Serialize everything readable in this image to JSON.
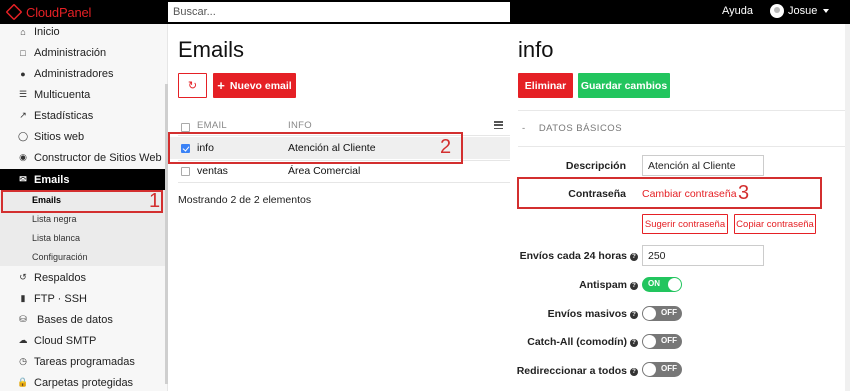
{
  "app": {
    "brand": "CloudPanel"
  },
  "topbar": {
    "search_placeholder": "Buscar...",
    "help": "Ayuda",
    "user": "Josue"
  },
  "sidebar": {
    "items": [
      {
        "label": "Inicio",
        "icon": "home-icon"
      },
      {
        "label": "Administración",
        "icon": "file-icon"
      },
      {
        "label": "Administradores",
        "icon": "users-icon"
      },
      {
        "label": "Multicuenta",
        "icon": "list-icon"
      },
      {
        "label": "Estadísticas",
        "icon": "chart-icon"
      },
      {
        "label": "Sitios web",
        "icon": "globe-icon"
      },
      {
        "label": "Constructor de Sitios Web",
        "icon": "palette-icon"
      },
      {
        "label": "Emails",
        "icon": "envelope-icon",
        "active": true
      },
      {
        "label": "Respaldos",
        "icon": "history-icon"
      },
      {
        "label": "FTP · SSH",
        "icon": "folder-icon"
      },
      {
        "label": "Bases de datos",
        "icon": "database-icon"
      },
      {
        "label": "Cloud SMTP",
        "icon": "cloud-icon"
      },
      {
        "label": "Tareas programadas",
        "icon": "clock-icon"
      },
      {
        "label": "Carpetas protegidas",
        "icon": "lock-icon"
      }
    ],
    "email_sub": [
      "Emails",
      "Lista negra",
      "Lista blanca",
      "Configuración"
    ]
  },
  "list": {
    "title": "Emails",
    "new_button": "Nuevo email",
    "columns": [
      "EMAIL",
      "INFO"
    ],
    "rows": [
      {
        "email": "info",
        "info": "Atención al Cliente",
        "selected": true
      },
      {
        "email": "ventas",
        "info": "Área Comercial",
        "selected": false
      }
    ],
    "footer": "Mostrando 2 de 2 elementos"
  },
  "detail": {
    "title": "info",
    "delete_button": "Eliminar",
    "save_button": "Guardar cambios",
    "section": "DATOS BÁSICOS",
    "section_dash": "-",
    "description_label": "Descripción",
    "description_value": "Atención al Cliente",
    "password_label": "Contraseña",
    "change_password": "Cambiar contraseña",
    "suggest_password": "Sugerir contraseña",
    "copy_password": "Copiar contraseña",
    "sends_label": "Envíos cada 24 horas",
    "sends_value": "250",
    "antispam_label": "Antispam",
    "antispam_state": "ON",
    "mass_label": "Envíos masivos",
    "mass_state": "OFF",
    "catchall_label": "Catch-All (comodín)",
    "catchall_state": "OFF",
    "redirect_label": "Redireccionar a todos",
    "redirect_state": "OFF"
  },
  "annotations": {
    "n1": "1",
    "n2": "2",
    "n3": "3"
  },
  "colors": {
    "brand_red": "#e52025",
    "success_green": "#22c55e",
    "annotation_red": "#d32f2f"
  }
}
